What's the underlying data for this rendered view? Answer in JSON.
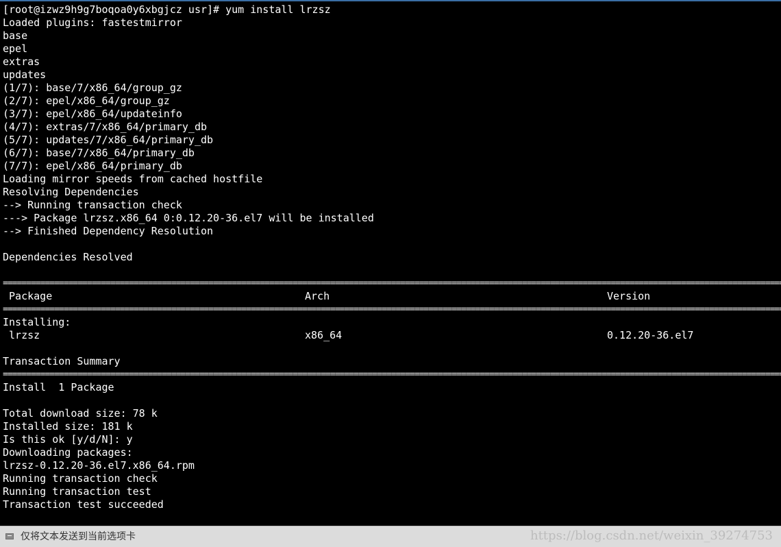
{
  "terminal": {
    "background": "#000000",
    "foreground": "#ffffff",
    "lines": [
      "[root@izwz9h9g7boqoa0y6xbgjcz usr]# yum install lrzsz",
      "Loaded plugins: fastestmirror",
      "base",
      "epel",
      "extras",
      "updates",
      "(1/7): base/7/x86_64/group_gz",
      "(2/7): epel/x86_64/group_gz",
      "(3/7): epel/x86_64/updateinfo",
      "(4/7): extras/7/x86_64/primary_db",
      "(5/7): updates/7/x86_64/primary_db",
      "(6/7): base/7/x86_64/primary_db",
      "(7/7): epel/x86_64/primary_db",
      "Loading mirror speeds from cached hostfile",
      "Resolving Dependencies",
      "--> Running transaction check",
      "---> Package lrzsz.x86_64 0:0.12.20-36.el7 will be installed",
      "--> Finished Dependency Resolution",
      "",
      "Dependencies Resolved",
      "",
      "========================================================================================================================================================================================================",
      "",
      "========================================================================================================================================================================================================",
      "Installing:",
      "",
      "",
      "Transaction Summary",
      "========================================================================================================================================================================================================",
      "Install  1 Package",
      "",
      "Total download size: 78 k",
      "Installed size: 181 k",
      "Is this ok [y/d/N]: y",
      "Downloading packages:",
      "lrzsz-0.12.20-36.el7.x86_64.rpm",
      "Running transaction check",
      "Running transaction test",
      "Transaction test succeeded"
    ],
    "table_header": {
      "package": " Package",
      "arch": "Arch",
      "version": "Version"
    },
    "table_row": {
      "package": " lrzsz",
      "arch": "x86_64",
      "version": "0.12.20-36.el7"
    }
  },
  "statusbar": {
    "icon": "send-icon",
    "label": "仅将文本发送到当前选项卡"
  },
  "watermark": "https://blog.csdn.net/weixin_39274753"
}
